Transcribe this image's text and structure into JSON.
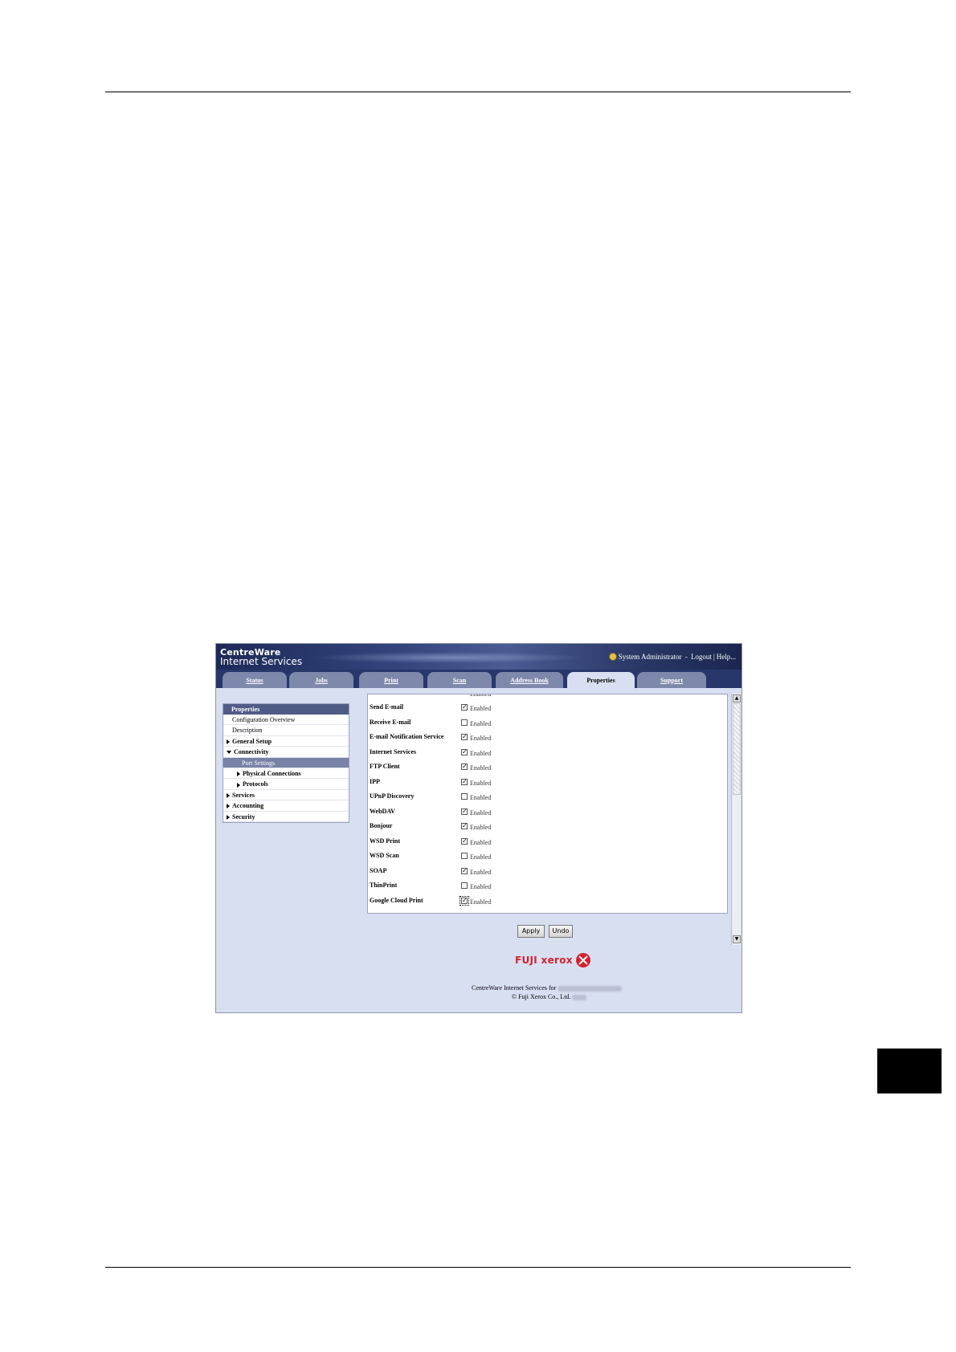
{
  "app": {
    "brand_line1": "CentreWare",
    "brand_line2": "Internet Services",
    "user": "System Administrator",
    "logout": "Logout",
    "help": "Help..."
  },
  "tabs": [
    {
      "label": "Status",
      "active": false
    },
    {
      "label": "Jobs",
      "active": false
    },
    {
      "label": "Print",
      "active": false
    },
    {
      "label": "Scan",
      "active": false
    },
    {
      "label": "Address Book",
      "active": false
    },
    {
      "label": "Properties",
      "active": true
    },
    {
      "label": "Support",
      "active": false
    }
  ],
  "nav": {
    "header": "Properties",
    "items": [
      {
        "label": "Configuration Overview"
      },
      {
        "label": "Description"
      },
      {
        "label": "General Setup"
      },
      {
        "label": "Connectivity"
      },
      {
        "label": "Port Settings"
      },
      {
        "label": "Physical Connections"
      },
      {
        "label": "Protocols"
      },
      {
        "label": "Services"
      },
      {
        "label": "Accounting"
      },
      {
        "label": "Security"
      }
    ]
  },
  "ports": {
    "enabled_label": "Enabled",
    "rows": [
      {
        "label": "Send E-mail",
        "checked": true
      },
      {
        "label": "Receive E-mail",
        "checked": false
      },
      {
        "label": "E-mail Notification Service",
        "checked": true
      },
      {
        "label": "Internet Services",
        "checked": true
      },
      {
        "label": "FTP Client",
        "checked": true
      },
      {
        "label": "IPP",
        "checked": true
      },
      {
        "label": "UPnP Discovery",
        "checked": false
      },
      {
        "label": "WebDAV",
        "checked": true
      },
      {
        "label": "Bonjour",
        "checked": true
      },
      {
        "label": "WSD Print",
        "checked": true
      },
      {
        "label": "WSD Scan",
        "checked": false
      },
      {
        "label": "SOAP",
        "checked": true
      },
      {
        "label": "ThinPrint",
        "checked": false
      },
      {
        "label": "Google Cloud Print",
        "checked": true
      }
    ]
  },
  "buttons": {
    "apply": "Apply",
    "undo": "Undo"
  },
  "footer": {
    "logo_text": "FUJI xerox",
    "line1": "CentreWare Internet Services for",
    "line2": "© Fuji Xerox Co., Ltd."
  },
  "icons": {
    "user": "person-icon",
    "logo_mark": "xerox-ball-icon"
  },
  "colors": {
    "banner": "#27376b",
    "brand_red": "#d4232f",
    "page_bg": "#d8dff0"
  }
}
